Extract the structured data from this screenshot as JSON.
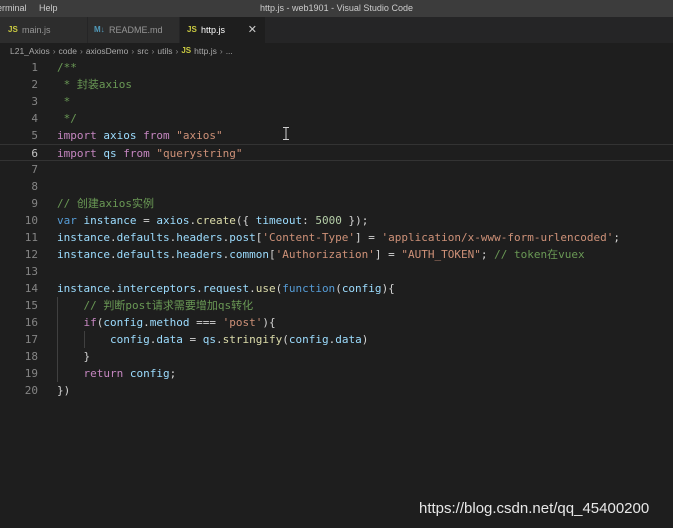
{
  "titlebar": {
    "menu": [
      "erminal",
      "Help"
    ],
    "title": "http.js - web1901 - Visual Studio Code"
  },
  "tabs": [
    {
      "icon": "JS",
      "label": "main.js",
      "icon_color": "#cbcb41"
    },
    {
      "icon": "M↓",
      "label": "README.md",
      "icon_color": "#519aba"
    },
    {
      "icon": "JS",
      "label": "http.js",
      "icon_color": "#cbcb41",
      "active": true,
      "close": "✕"
    }
  ],
  "breadcrumb": [
    "L21_Axios",
    "code",
    "axiosDemo",
    "src",
    "utils",
    "http.js",
    "..."
  ],
  "breadcrumb_file_icon": "JS",
  "line_numbers": [
    "1",
    "2",
    "3",
    "4",
    "5",
    "6",
    "7",
    "8",
    "9",
    "10",
    "11",
    "12",
    "13",
    "14",
    "15",
    "16",
    "17",
    "18",
    "19",
    "20"
  ],
  "current_line": 6,
  "code_lines": [
    [
      {
        "t": "/**",
        "c": "cm"
      }
    ],
    [
      {
        "t": " * 封装axios",
        "c": "cm"
      }
    ],
    [
      {
        "t": " *",
        "c": "cm"
      }
    ],
    [
      {
        "t": " */",
        "c": "cm"
      }
    ],
    [
      {
        "t": "import ",
        "c": "kw"
      },
      {
        "t": "axios ",
        "c": "var"
      },
      {
        "t": "from ",
        "c": "kw"
      },
      {
        "t": "\"axios\"",
        "c": "str"
      }
    ],
    [
      {
        "t": "import ",
        "c": "kw"
      },
      {
        "t": "qs ",
        "c": "var"
      },
      {
        "t": "from ",
        "c": "kw"
      },
      {
        "t": "\"querystring\"",
        "c": "str"
      }
    ],
    [],
    [],
    [
      {
        "t": "// 创建axios实例",
        "c": "cm"
      }
    ],
    [
      {
        "t": "var ",
        "c": "kw2"
      },
      {
        "t": "instance",
        "c": "var"
      },
      {
        "t": " = ",
        "c": "pl"
      },
      {
        "t": "axios",
        "c": "var"
      },
      {
        "t": ".",
        "c": "pl"
      },
      {
        "t": "create",
        "c": "fn"
      },
      {
        "t": "({ ",
        "c": "pl"
      },
      {
        "t": "timeout",
        "c": "var"
      },
      {
        "t": ": ",
        "c": "pl"
      },
      {
        "t": "5000",
        "c": "num"
      },
      {
        "t": " });",
        "c": "pl"
      }
    ],
    [
      {
        "t": "instance",
        "c": "var"
      },
      {
        "t": ".",
        "c": "pl"
      },
      {
        "t": "defaults",
        "c": "var"
      },
      {
        "t": ".",
        "c": "pl"
      },
      {
        "t": "headers",
        "c": "var"
      },
      {
        "t": ".",
        "c": "pl"
      },
      {
        "t": "post",
        "c": "var"
      },
      {
        "t": "[",
        "c": "pl"
      },
      {
        "t": "'Content-Type'",
        "c": "str"
      },
      {
        "t": "] = ",
        "c": "pl"
      },
      {
        "t": "'application/x-www-form-urlencoded'",
        "c": "str"
      },
      {
        "t": ";",
        "c": "pl"
      }
    ],
    [
      {
        "t": "instance",
        "c": "var"
      },
      {
        "t": ".",
        "c": "pl"
      },
      {
        "t": "defaults",
        "c": "var"
      },
      {
        "t": ".",
        "c": "pl"
      },
      {
        "t": "headers",
        "c": "var"
      },
      {
        "t": ".",
        "c": "pl"
      },
      {
        "t": "common",
        "c": "var"
      },
      {
        "t": "[",
        "c": "pl"
      },
      {
        "t": "'Authorization'",
        "c": "str"
      },
      {
        "t": "] = ",
        "c": "pl"
      },
      {
        "t": "\"AUTH_TOKEN\"",
        "c": "str"
      },
      {
        "t": "; ",
        "c": "pl"
      },
      {
        "t": "// token在vuex",
        "c": "cm"
      }
    ],
    [],
    [
      {
        "t": "instance",
        "c": "var"
      },
      {
        "t": ".",
        "c": "pl"
      },
      {
        "t": "interceptors",
        "c": "var"
      },
      {
        "t": ".",
        "c": "pl"
      },
      {
        "t": "request",
        "c": "var"
      },
      {
        "t": ".",
        "c": "pl"
      },
      {
        "t": "use",
        "c": "fn"
      },
      {
        "t": "(",
        "c": "pl"
      },
      {
        "t": "function",
        "c": "kw2"
      },
      {
        "t": "(",
        "c": "pl"
      },
      {
        "t": "config",
        "c": "var"
      },
      {
        "t": "){",
        "c": "pl"
      }
    ],
    [
      {
        "t": "    ",
        "c": "pl"
      },
      {
        "t": "// 判断post请求需要增加qs转化",
        "c": "cm"
      }
    ],
    [
      {
        "t": "    ",
        "c": "pl"
      },
      {
        "t": "if",
        "c": "kw"
      },
      {
        "t": "(",
        "c": "pl"
      },
      {
        "t": "config",
        "c": "var"
      },
      {
        "t": ".",
        "c": "pl"
      },
      {
        "t": "method",
        "c": "var"
      },
      {
        "t": " === ",
        "c": "pl"
      },
      {
        "t": "'post'",
        "c": "str"
      },
      {
        "t": "){",
        "c": "pl"
      }
    ],
    [
      {
        "t": "        ",
        "c": "pl"
      },
      {
        "t": "config",
        "c": "var"
      },
      {
        "t": ".",
        "c": "pl"
      },
      {
        "t": "data",
        "c": "var"
      },
      {
        "t": " = ",
        "c": "pl"
      },
      {
        "t": "qs",
        "c": "var"
      },
      {
        "t": ".",
        "c": "pl"
      },
      {
        "t": "stringify",
        "c": "fn"
      },
      {
        "t": "(",
        "c": "pl"
      },
      {
        "t": "config",
        "c": "var"
      },
      {
        "t": ".",
        "c": "pl"
      },
      {
        "t": "data",
        "c": "var"
      },
      {
        "t": ")",
        "c": "pl"
      }
    ],
    [
      {
        "t": "    }",
        "c": "pl"
      }
    ],
    [
      {
        "t": "    ",
        "c": "pl"
      },
      {
        "t": "return ",
        "c": "kw"
      },
      {
        "t": "config",
        "c": "var"
      },
      {
        "t": ";",
        "c": "pl"
      }
    ],
    [
      {
        "t": "})",
        "c": "pl"
      }
    ]
  ],
  "watermark": "https://blog.csdn.net/qq_45400200"
}
